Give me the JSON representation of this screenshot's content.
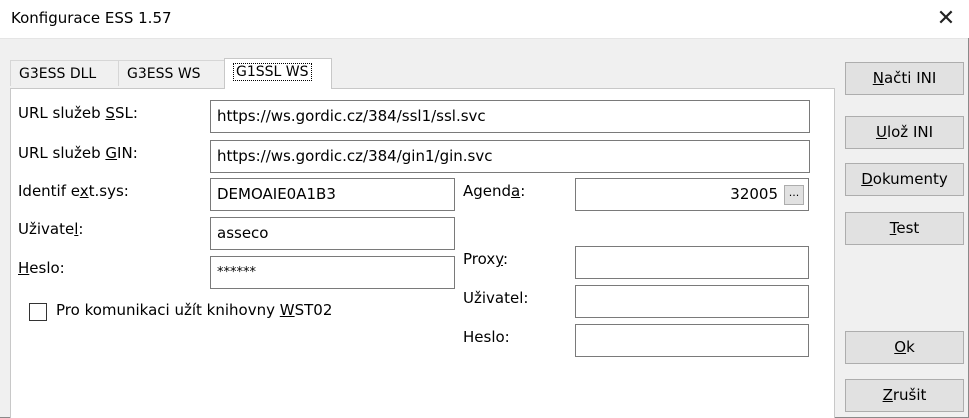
{
  "window": {
    "title": "Konfigurace ESS 1.57",
    "close_glyph": "✕"
  },
  "tabs": [
    {
      "label": "G3ESS DLL"
    },
    {
      "label": "G3ESS WS"
    },
    {
      "label": "G1SSL WS"
    }
  ],
  "form": {
    "url_ssl": {
      "label_pre": "URL služeb ",
      "label_acc": "S",
      "label_post": "SL:",
      "value": "https://ws.gordic.cz/384/ssl1/ssl.svc"
    },
    "url_gin": {
      "label_pre": "URL služeb ",
      "label_acc": "G",
      "label_post": "IN:",
      "value": "https://ws.gordic.cz/384/gin1/gin.svc"
    },
    "identif": {
      "label_pre": "Identif e",
      "label_acc": "x",
      "label_post": "t.sys:",
      "value": "DEMOAIE0A1B3"
    },
    "agenda": {
      "label_pre": "Agend",
      "label_acc": "a",
      "label_post": ":",
      "value": "32005",
      "ellipsis": "..."
    },
    "uzivatel": {
      "label_pre": "Uživate",
      "label_acc": "l",
      "label_post": ":",
      "value": "asseco"
    },
    "heslo": {
      "label_pre": "",
      "label_acc": "H",
      "label_post": "eslo:",
      "value": "******"
    },
    "proxy": {
      "label_pre": "Prox",
      "label_acc": "y",
      "label_post": ":",
      "value": ""
    },
    "proxy_uzivatel": {
      "label": "Uživatel:",
      "value": ""
    },
    "proxy_heslo": {
      "label": "Heslo:",
      "value": ""
    },
    "checkbox": {
      "label_pre": "Pro komunikaci užít knihovny ",
      "label_acc": "W",
      "label_post": "ST02",
      "checked": false
    }
  },
  "buttons": {
    "nacti_ini": {
      "acc": "N",
      "rest": "ačti INI"
    },
    "uloz_ini": {
      "acc": "U",
      "rest": "lož INI"
    },
    "dokumenty": {
      "acc": "D",
      "rest": "okumenty"
    },
    "test": {
      "acc": "T",
      "rest": "est"
    },
    "ok": {
      "acc": "O",
      "rest": "k"
    },
    "zrusit": {
      "acc": "Z",
      "rest": "rušit"
    }
  }
}
